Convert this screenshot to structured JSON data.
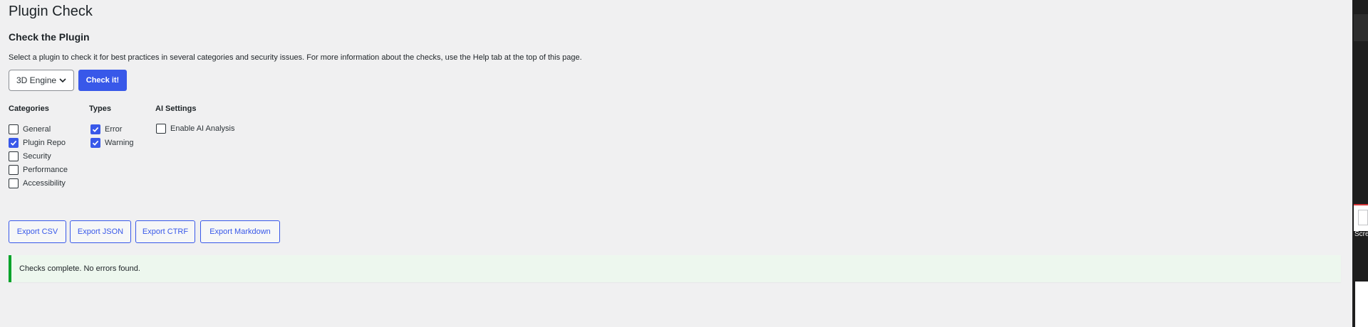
{
  "page": {
    "title": "Plugin Check",
    "section_title": "Check the Plugin",
    "description": "Select a plugin to check it for best practices in several categories and security issues. For more information about the checks, use the Help tab at the top of this page."
  },
  "form": {
    "plugin_select": {
      "selected": "3D Engine"
    },
    "check_button": "Check it!"
  },
  "categories": {
    "title": "Categories",
    "items": [
      {
        "label": "General",
        "checked": false
      },
      {
        "label": "Plugin Repo",
        "checked": true
      },
      {
        "label": "Security",
        "checked": false
      },
      {
        "label": "Performance",
        "checked": false
      },
      {
        "label": "Accessibility",
        "checked": false
      }
    ]
  },
  "types": {
    "title": "Types",
    "items": [
      {
        "label": "Error",
        "checked": true
      },
      {
        "label": "Warning",
        "checked": true
      }
    ]
  },
  "ai_settings": {
    "title": "AI Settings",
    "items": [
      {
        "label": "Enable AI Analysis",
        "checked": false
      }
    ]
  },
  "exports": [
    "Export CSV",
    "Export JSON",
    "Export CTRF",
    "Export Markdown"
  ],
  "notice": {
    "text": "Checks complete. No errors found."
  },
  "right_window": {
    "label": "Scre"
  },
  "colors": {
    "accent": "#3858e9",
    "success": "#00a32a",
    "background": "#f0f0f1"
  }
}
